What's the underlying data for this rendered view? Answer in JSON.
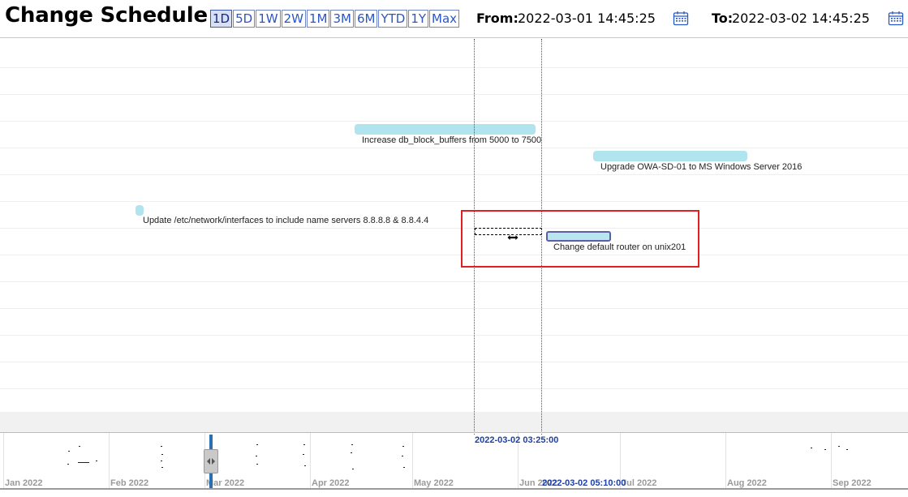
{
  "header": {
    "title": "Change Schedule",
    "ranges": [
      {
        "label": "1D",
        "active": true
      },
      {
        "label": "5D"
      },
      {
        "label": "1W"
      },
      {
        "label": "2W"
      },
      {
        "label": "1M"
      },
      {
        "label": "3M"
      },
      {
        "label": "6M"
      },
      {
        "label": "YTD"
      },
      {
        "label": "1Y"
      },
      {
        "label": "Max"
      }
    ],
    "from_label": "From:",
    "from_value": "2022-03-01 14:45:25",
    "to_label": "To:",
    "to_value": "2022-03-02 14:45:25",
    "calendar_icon": "calendar-icon"
  },
  "tasks": [
    {
      "label": "Increase db_block_buffers from 5000 to 7500"
    },
    {
      "label": "Upgrade OWA-SD-01 to MS Windows Server 2016"
    },
    {
      "label": "Update /etc/network/interfaces to include name servers 8.8.8.8 & 8.8.4.4"
    },
    {
      "label": "Change default router on unix201",
      "selected": true
    }
  ],
  "overview": {
    "months": [
      "Jan 2022",
      "Feb 2022",
      "Mar 2022",
      "Apr 2022",
      "May 2022",
      "Jun 2022",
      "Jul 2022",
      "Aug 2022",
      "Sep 2022"
    ],
    "range_start": "2022-03-02 03:25:00",
    "range_end": "2022-03-02 05:10:00"
  },
  "colors": {
    "task_bar": "#b0e4ee",
    "selected_border": "#5a5fa8",
    "highlight": "#e02020",
    "timestamp": "#1d3fa6"
  }
}
